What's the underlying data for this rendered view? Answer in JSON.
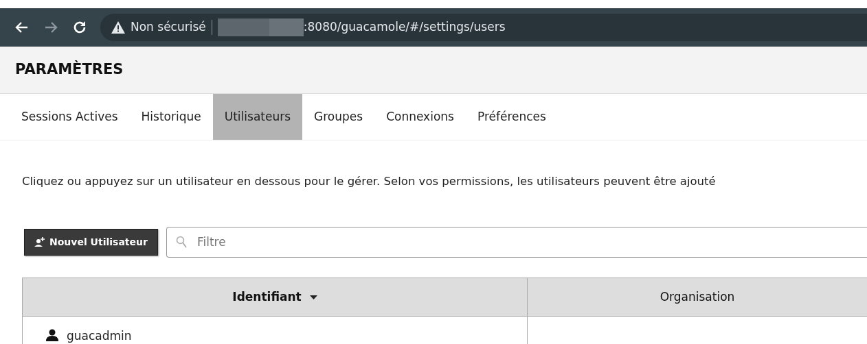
{
  "browser": {
    "security_label": "Non sécurisé",
    "url": ":8080/guacamole/#/settings/users"
  },
  "header": {
    "title": "PARAMÈTRES"
  },
  "tabs": [
    {
      "label": "Sessions Actives",
      "selected": false
    },
    {
      "label": "Historique",
      "selected": false
    },
    {
      "label": "Utilisateurs",
      "selected": true
    },
    {
      "label": "Groupes",
      "selected": false
    },
    {
      "label": "Connexions",
      "selected": false
    },
    {
      "label": "Préférences",
      "selected": false
    }
  ],
  "description": "Cliquez ou appuyez sur un utilisateur en dessous pour le gérer. Selon vos permissions, les utilisateurs peuvent être ajouté",
  "new_button": {
    "label": "Nouvel Utilisateur"
  },
  "filter": {
    "placeholder": "Filtre"
  },
  "table": {
    "columns": [
      {
        "label": "Identifiant",
        "sorted": true
      },
      {
        "label": "Organisation",
        "sorted": false
      }
    ],
    "rows": [
      {
        "username": "guacadmin"
      }
    ]
  }
}
